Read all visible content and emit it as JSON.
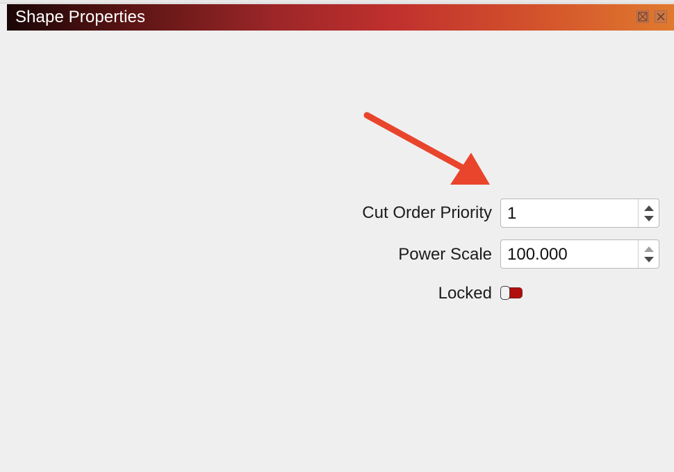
{
  "window": {
    "title": "Shape Properties",
    "gradient_colors": [
      "#1a0606",
      "#9c2628",
      "#c0302e",
      "#e07a2e"
    ]
  },
  "fields": {
    "cut_order_priority": {
      "label": "Cut Order Priority",
      "value": "1"
    },
    "power_scale": {
      "label": "Power Scale",
      "value": "100.000"
    },
    "locked": {
      "label": "Locked",
      "checked": false
    }
  },
  "annotation": {
    "arrow_color": "#e8452c"
  },
  "icons": [
    "float-icon",
    "close-icon",
    "arrow-up-icon",
    "arrow-down-icon",
    "annotation-arrow-icon"
  ]
}
